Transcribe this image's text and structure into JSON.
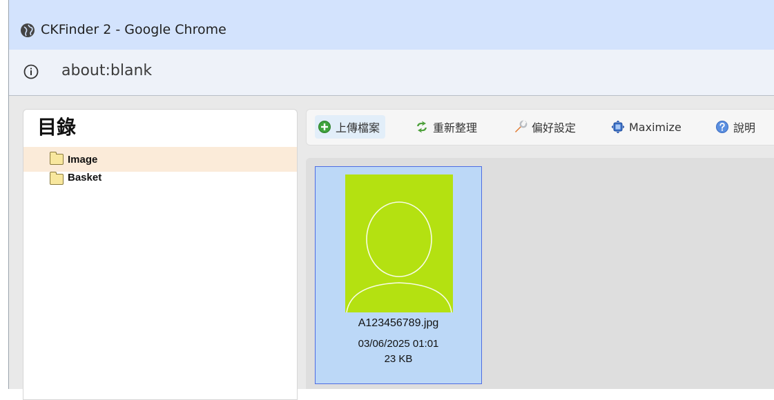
{
  "window": {
    "title": "CKFinder 2 - Google Chrome",
    "icon": "globe-icon"
  },
  "address": {
    "url": "about:blank",
    "icon": "info-icon"
  },
  "folders": {
    "title": "目錄",
    "items": [
      {
        "label": "Image",
        "selected": true
      },
      {
        "label": "Basket",
        "selected": false
      }
    ]
  },
  "toolbar": {
    "upload_label": "上傳檔案",
    "refresh_label": "重新整理",
    "settings_label": "偏好設定",
    "maximize_label": "Maximize",
    "help_label": "說明"
  },
  "files": [
    {
      "name": "A123456789.jpg",
      "date": "03/06/2025 01:01",
      "size": "23 KB",
      "selected": true,
      "thumb_color": "#b4e111"
    }
  ],
  "colors": {
    "titlebar": "#d3e3fd",
    "selected_folder": "#fbebd9",
    "selected_file": "#bcd8f7",
    "selected_file_border": "#4d6ce2"
  }
}
